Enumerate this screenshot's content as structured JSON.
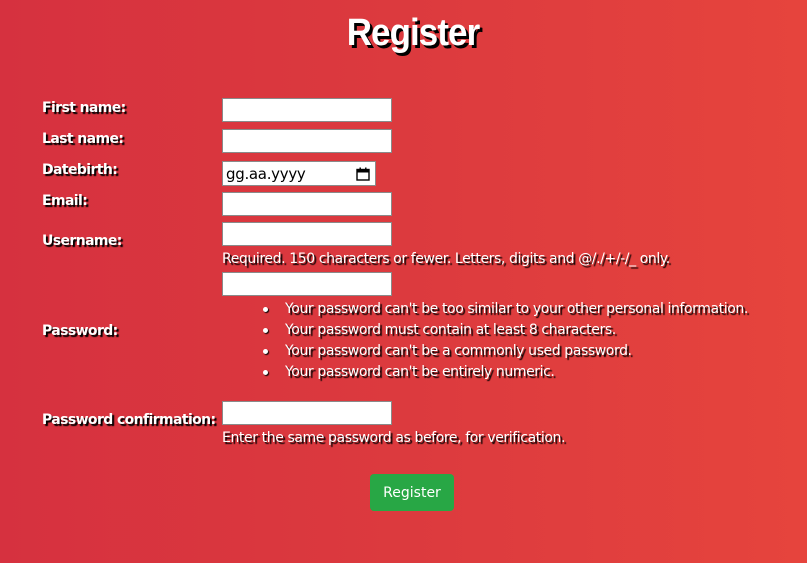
{
  "page": {
    "title": "Register"
  },
  "form": {
    "first_name": {
      "label": "First name:",
      "value": ""
    },
    "last_name": {
      "label": "Last name:",
      "value": ""
    },
    "datebirth": {
      "label": "Datebirth:",
      "placeholder": "gg.aa.yyyy",
      "icon": "calendar-icon"
    },
    "email": {
      "label": "Email:",
      "value": ""
    },
    "username": {
      "label": "Username:",
      "value": "",
      "help": "Required. 150 characters or fewer. Letters, digits and @/./+/-/_ only."
    },
    "password": {
      "label": "Password:",
      "value": "",
      "rules": [
        "Your password can't be too similar to your other personal information.",
        "Your password must contain at least 8 characters.",
        "Your password can't be a commonly used password.",
        "Your password can't be entirely numeric."
      ]
    },
    "password_confirmation": {
      "label": "Password confirmation:",
      "value": "",
      "help": "Enter the same password as before, for verification."
    },
    "submit_label": "Register"
  },
  "colors": {
    "background_start": "#d6313f",
    "background_end": "#e6443d",
    "button": "#28a745",
    "text": "#ffffff",
    "text_shadow": "#000000"
  }
}
